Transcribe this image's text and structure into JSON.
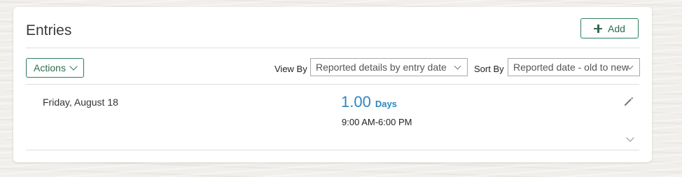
{
  "section": {
    "title": "Entries",
    "add_label": "Add",
    "actions_label": "Actions"
  },
  "view_by": {
    "label": "View By",
    "selected": "Reported details by entry date"
  },
  "sort_by": {
    "label": "Sort By",
    "selected": "Reported date - old to new"
  },
  "entries": [
    {
      "date": "Friday, August 18",
      "amount": "1.00",
      "unit": "Days",
      "time_range": "9:00 AM-6:00 PM"
    }
  ],
  "icons": {
    "add": "plus-icon",
    "actions_dropdown": "chevron-down-icon",
    "edit": "pencil-icon",
    "expand": "chevron-down-icon"
  },
  "colors": {
    "accent_green": "#2e6b4f",
    "value_blue": "#2f85c0"
  }
}
